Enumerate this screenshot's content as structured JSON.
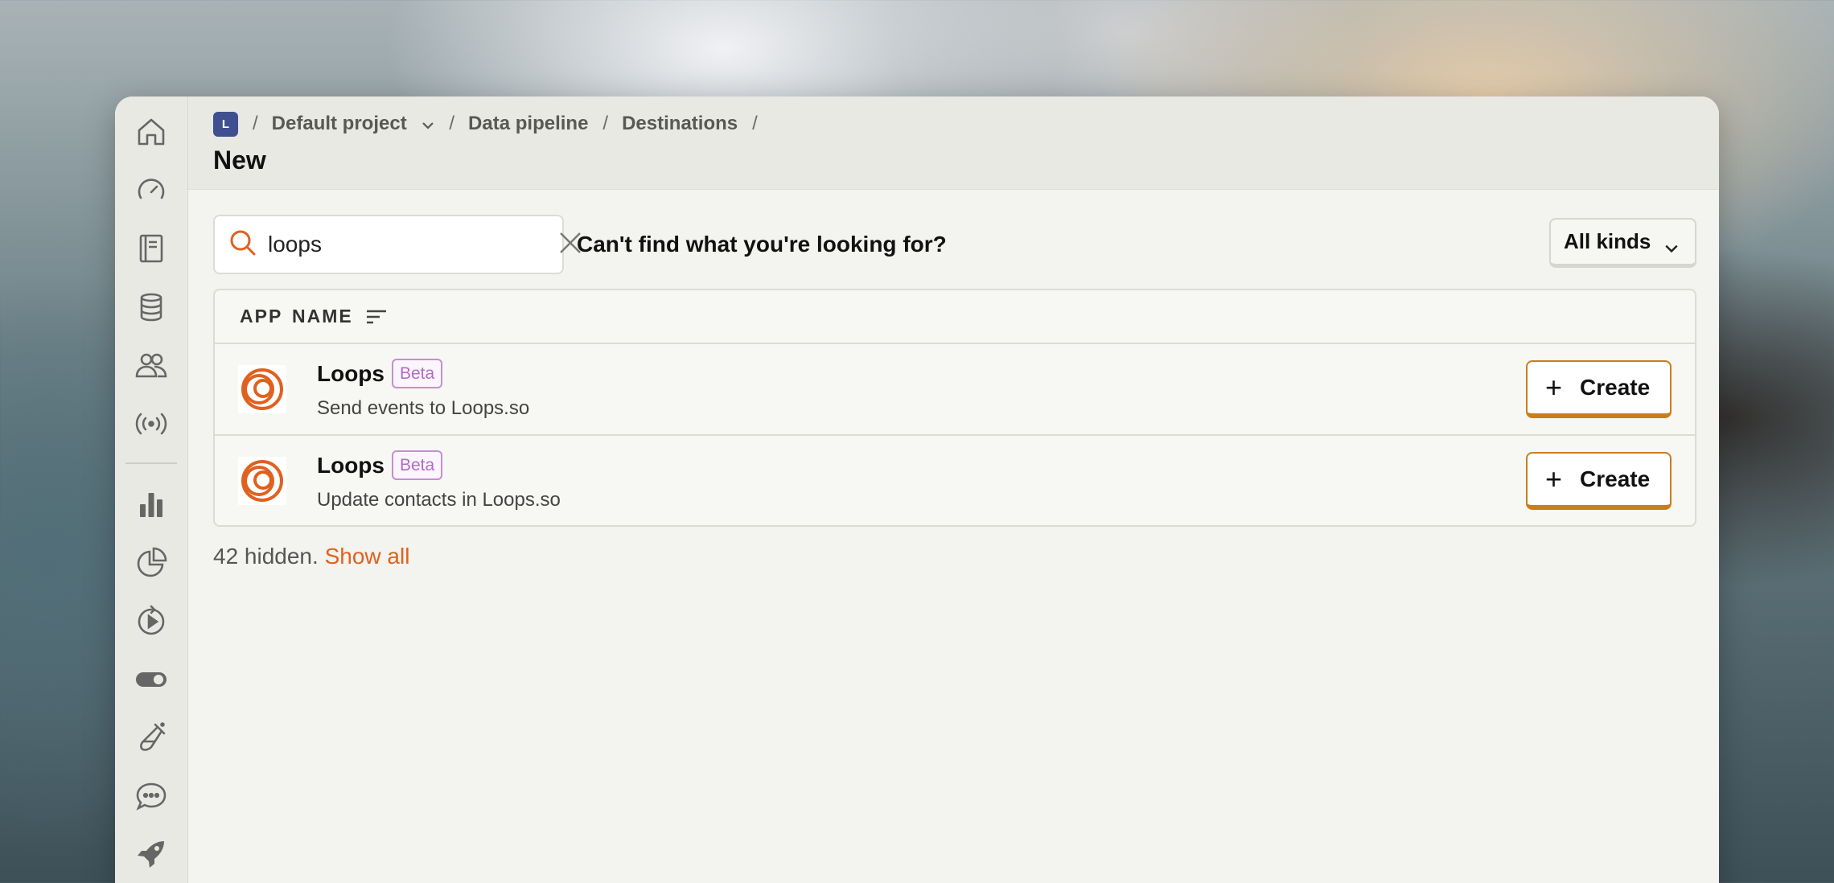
{
  "colors": {
    "accent": "#e0611f",
    "project_badge": "#3f4f8f",
    "beta": "#b36bc6",
    "create_border": "#c97e1b"
  },
  "sidebar": {
    "items": [
      {
        "icon": "home-icon"
      },
      {
        "icon": "dashboard-icon"
      },
      {
        "icon": "notebook-icon"
      },
      {
        "icon": "database-icon"
      },
      {
        "icon": "people-icon"
      },
      {
        "icon": "broadcast-icon"
      },
      {
        "icon": "bar-chart-icon"
      },
      {
        "icon": "pie-chart-icon"
      },
      {
        "icon": "replay-icon"
      },
      {
        "icon": "toggle-icon"
      },
      {
        "icon": "flask-icon"
      },
      {
        "icon": "chat-icon"
      },
      {
        "icon": "rocket-icon"
      }
    ]
  },
  "breadcrumb": {
    "project_initial": "L",
    "sep": "/",
    "items": [
      "Default project",
      "Data pipeline",
      "Destinations"
    ]
  },
  "page": {
    "title": "New"
  },
  "search": {
    "value": "loops",
    "placeholder": "Search"
  },
  "help_text": "Can't find what you're looking for?",
  "filter": {
    "selected": "All kinds"
  },
  "table": {
    "columns": [
      "APP",
      "NAME"
    ],
    "rows": [
      {
        "name": "Loops",
        "badge": "Beta",
        "description": "Send events to Loops.so",
        "action": "Create"
      },
      {
        "name": "Loops",
        "badge": "Beta",
        "description": "Update contacts in Loops.so",
        "action": "Create"
      }
    ]
  },
  "footer": {
    "hidden_text": "42 hidden.",
    "show_all": "Show all"
  }
}
